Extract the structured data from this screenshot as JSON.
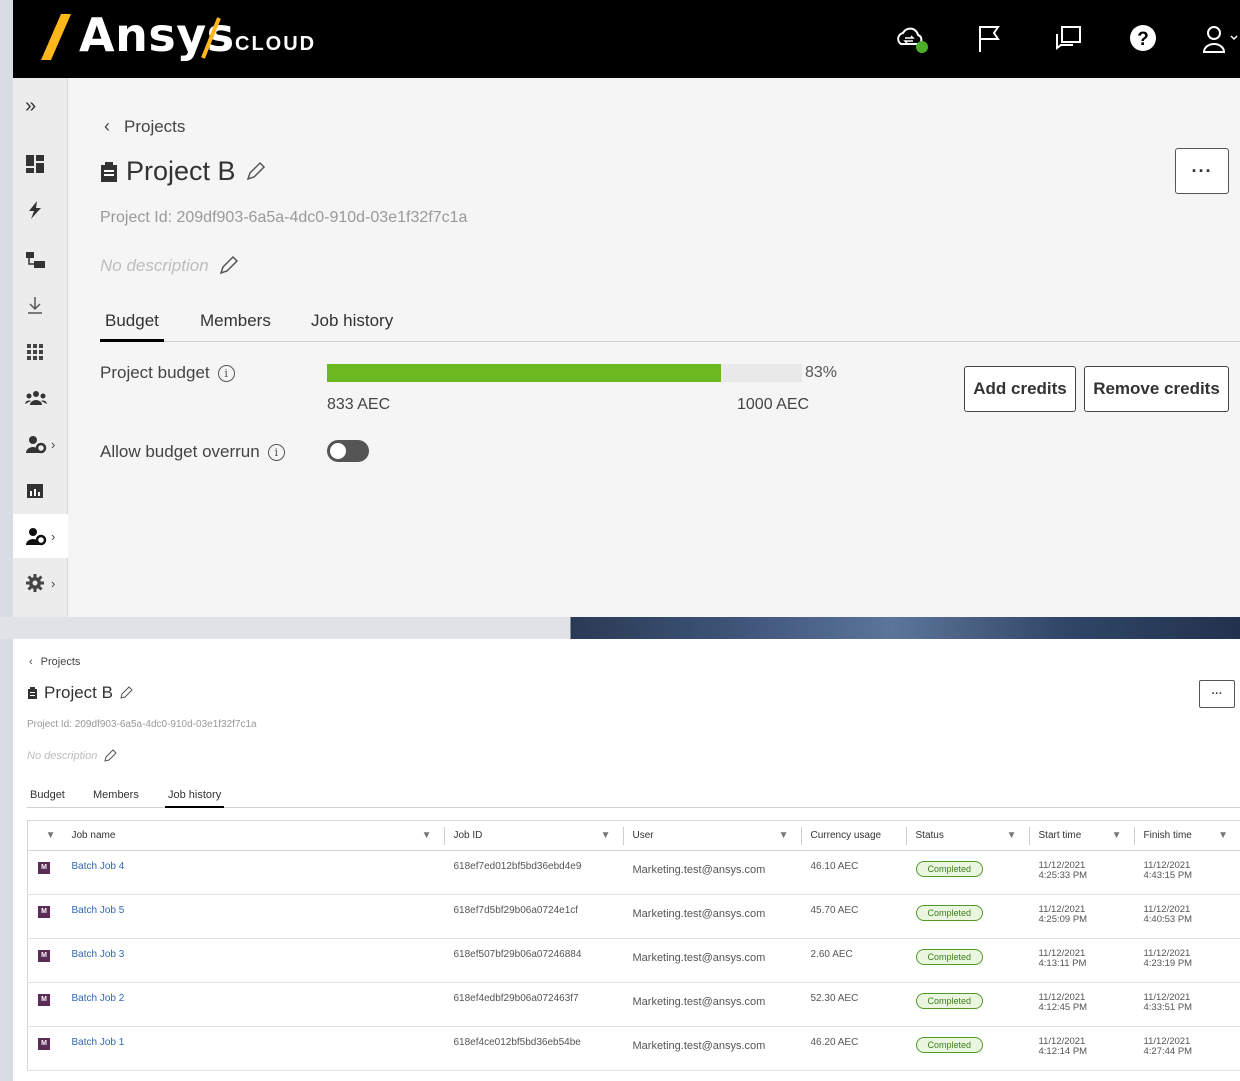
{
  "top": {
    "brand": {
      "name": "Ansys",
      "product": "CLOUD"
    },
    "header_icons": [
      "cloud-sync-icon",
      "flag-icon",
      "messages-icon",
      "help-icon",
      "user-icon"
    ],
    "breadcrumb": "Projects",
    "title": "Project B",
    "project_id": "Project Id: 209df903-6a5a-4dc0-910d-03e1f32f7c1a",
    "description": "No description",
    "more": "···",
    "tabs": [
      "Budget",
      "Members",
      "Job history"
    ],
    "active_tab": "Budget",
    "budget": {
      "label": "Project budget",
      "percent": "83%",
      "fill_fraction": 0.83,
      "used": "833 AEC",
      "total": "1000 AEC",
      "add": "Add credits",
      "remove": "Remove credits"
    },
    "overrun": {
      "label": "Allow budget overrun",
      "enabled": false
    },
    "sidebar": [
      "expand-icon",
      "dashboard-icon",
      "lightning-icon",
      "folders-icon",
      "download-icon",
      "apps-grid-icon",
      "users-group-icon",
      "user-settings-icon",
      "reports-icon",
      "project-admin-icon",
      "settings-gear-icon"
    ]
  },
  "bottom": {
    "breadcrumb": "Projects",
    "title": "Project B",
    "project_id": "Project Id: 209df903-6a5a-4dc0-910d-03e1f32f7c1a",
    "description": "No description",
    "more": "···",
    "tabs": [
      "Budget",
      "Members",
      "Job history"
    ],
    "active_tab": "Job history",
    "columns": [
      "Job name",
      "Job ID",
      "User",
      "Currency usage",
      "Status",
      "Start time",
      "Finish time"
    ],
    "rows": [
      {
        "name": "Batch Job 4",
        "id": "618ef7ed012bf5bd36ebd4e9",
        "user": "Marketing.test@ansys.com",
        "usage": "46.10 AEC",
        "status": "Completed",
        "start_date": "11/12/2021",
        "start_time": "4:25:33 PM",
        "finish_date": "11/12/2021",
        "finish_time": "4:43:15 PM"
      },
      {
        "name": "Batch Job 5",
        "id": "618ef7d5bf29b06a0724e1cf",
        "user": "Marketing.test@ansys.com",
        "usage": "45.70 AEC",
        "status": "Completed",
        "start_date": "11/12/2021",
        "start_time": "4:25:09 PM",
        "finish_date": "11/12/2021",
        "finish_time": "4:40:53 PM"
      },
      {
        "name": "Batch Job 3",
        "id": "618ef507bf29b06a07246884",
        "user": "Marketing.test@ansys.com",
        "usage": "2.60 AEC",
        "status": "Completed",
        "start_date": "11/12/2021",
        "start_time": "4:13:11 PM",
        "finish_date": "11/12/2021",
        "finish_time": "4:23:19 PM"
      },
      {
        "name": "Batch Job 2",
        "id": "618ef4edbf29b06a072463f7",
        "user": "Marketing.test@ansys.com",
        "usage": "52.30 AEC",
        "status": "Completed",
        "start_date": "11/12/2021",
        "start_time": "4:12:45 PM",
        "finish_date": "11/12/2021",
        "finish_time": "4:33:51 PM"
      },
      {
        "name": "Batch Job 1",
        "id": "618ef4ce012bf5bd36eb54be",
        "user": "Marketing.test@ansys.com",
        "usage": "46.20 AEC",
        "status": "Completed",
        "start_date": "11/12/2021",
        "start_time": "4:12:14 PM",
        "finish_date": "11/12/2021",
        "finish_time": "4:27:44 PM"
      }
    ]
  },
  "colors": {
    "accent_yellow": "#ffb71b",
    "budget_green": "#6bb821",
    "status_green": "#3e7f1e",
    "link_blue": "#2f6bb3"
  }
}
